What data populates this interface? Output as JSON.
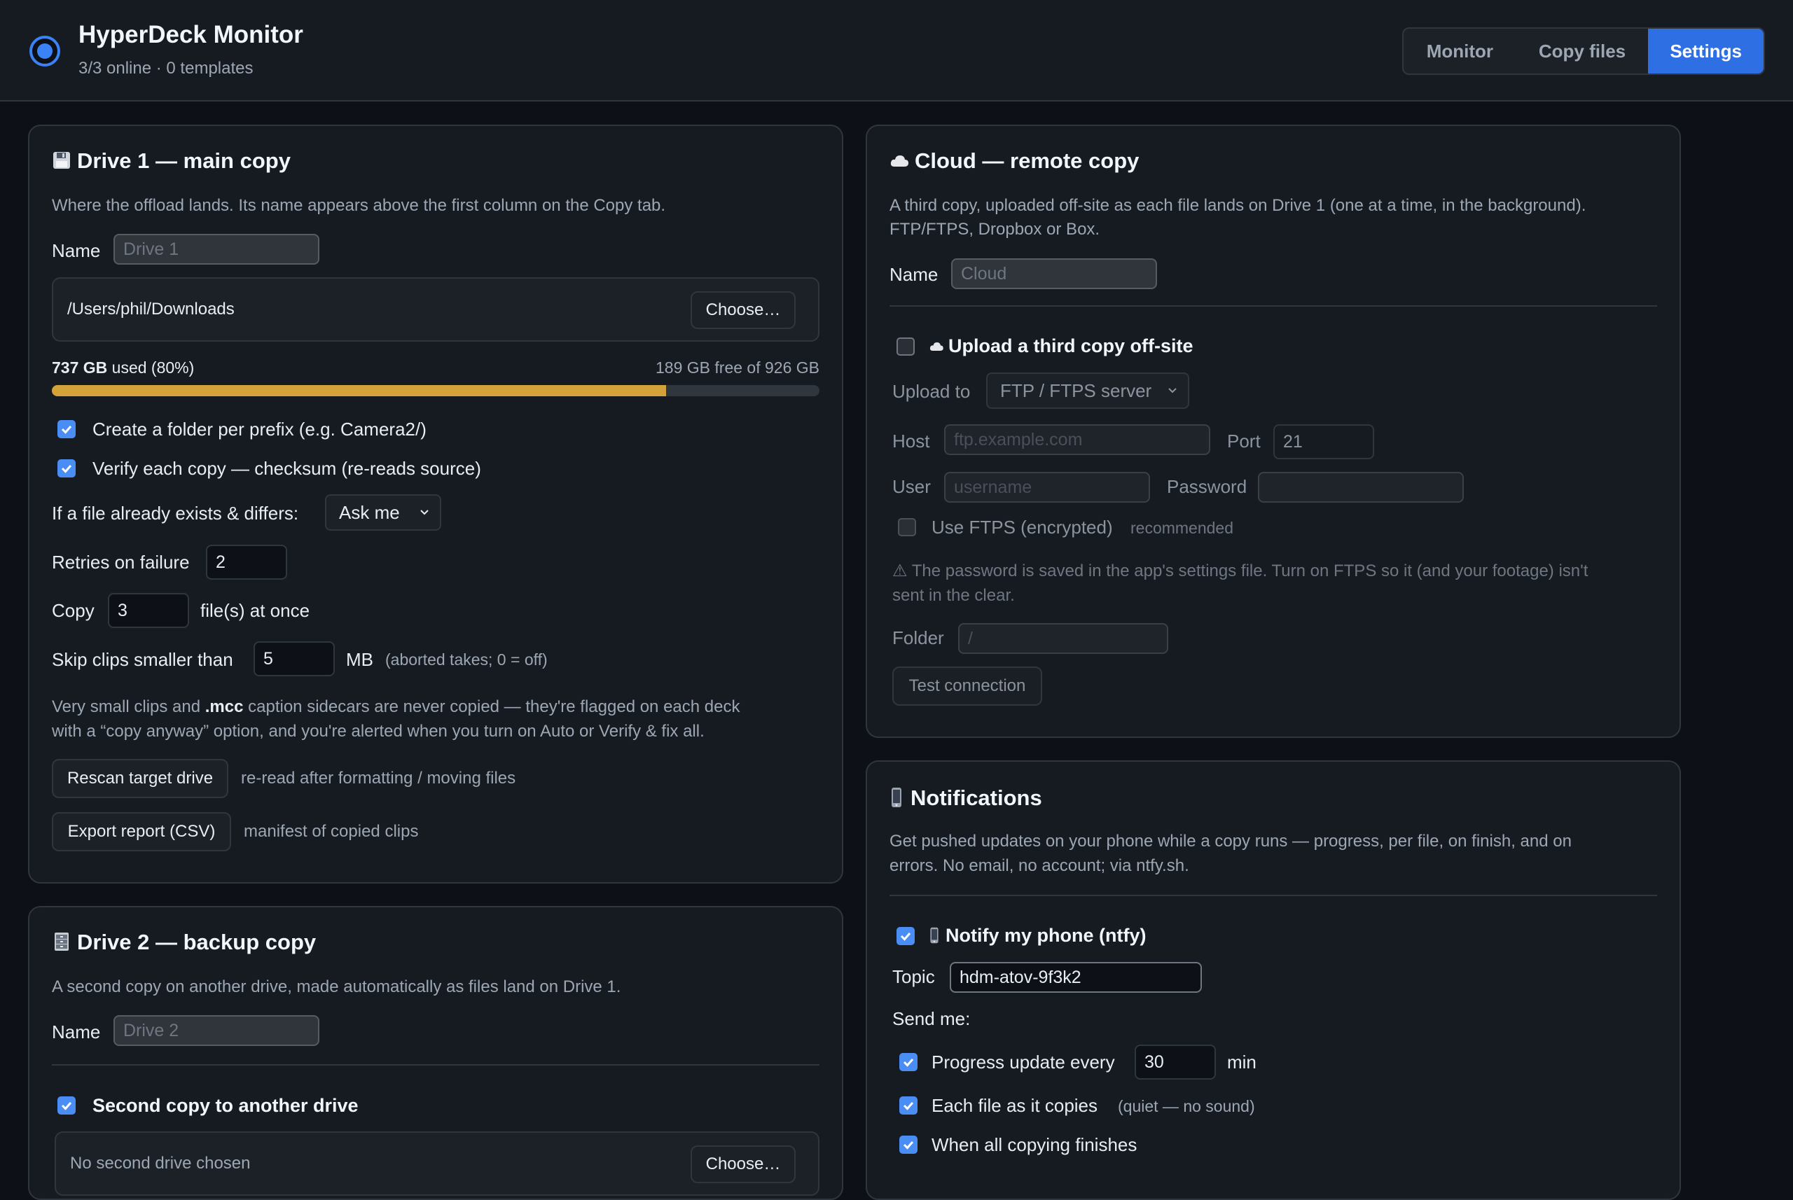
{
  "header": {
    "title": "HyperDeck Monitor",
    "subtitle": "3/3 online · 0 templates",
    "tabs": [
      {
        "label": "Monitor"
      },
      {
        "label": "Copy files"
      },
      {
        "label": "Settings"
      }
    ],
    "active_tab": "Settings"
  },
  "drive1": {
    "icon": "floppy-disk-icon",
    "title": "Drive 1 — main copy",
    "description": "Where the offload lands. Its name appears above the first column on the Copy tab.",
    "name_label": "Name",
    "name_placeholder": "Drive 1",
    "path": "/Users/phil/Downloads",
    "choose_label": "Choose…",
    "used_amount": "737 GB",
    "used_suffix": " used (80%)",
    "free_text": "189 GB free of 926 GB",
    "used_fraction": 0.8,
    "opt_folder_per_prefix": "Create a folder per prefix (e.g. Camera2/)",
    "opt_verify": "Verify each copy — checksum (re-reads source)",
    "exists_label": "If a file already exists & differs:",
    "exists_value": "Ask me",
    "retries_label": "Retries on failure",
    "retries_value": "2",
    "copy_label": "Copy",
    "copy_value": "3",
    "copy_suffix": "file(s) at once",
    "skip_label": "Skip clips smaller than",
    "skip_value": "5",
    "skip_unit": "MB",
    "skip_hint": "(aborted takes; 0 = off)",
    "note_line1_a": "Very small clips and ",
    "note_line1_b": ".mcc",
    "note_line1_c": " caption sidecars are never copied — they're flagged on each deck",
    "note_line2": "with a “copy anyway” option, and you're alerted when you turn on Auto or Verify & fix all.",
    "rescan_label": "Rescan target drive",
    "rescan_hint": "re-read after formatting / moving files",
    "export_label": "Export report (CSV)",
    "export_hint": "manifest of copied clips"
  },
  "drive2": {
    "icon": "file-cabinet-icon",
    "title": "Drive 2 — backup copy",
    "description": "A second copy on another drive, made automatically as files land on Drive 1.",
    "name_label": "Name",
    "name_placeholder": "Drive 2",
    "second_copy_label": "Second copy to another drive",
    "path_placeholder": "No second drive chosen",
    "choose_label": "Choose…"
  },
  "cloud": {
    "icon": "cloud-icon",
    "title": "Cloud — remote copy",
    "description_line1": "A third copy, uploaded off-site as each file lands on Drive 1 (one at a time, in the background).",
    "description_line2": "FTP/FTPS, Dropbox or Box.",
    "name_label": "Name",
    "name_placeholder": "Cloud",
    "upload_label": "Upload a third copy off-site",
    "upload_to_label": "Upload to",
    "upload_to_value": "FTP / FTPS server",
    "host_label": "Host",
    "host_placeholder": "ftp.example.com",
    "port_label": "Port",
    "port_value": "21",
    "user_label": "User",
    "user_placeholder": "username",
    "password_label": "Password",
    "ftps_label": "Use FTPS (encrypted)",
    "ftps_hint": "recommended",
    "warning_line1": "⚠ The password is saved in the app's settings file. Turn on FTPS so it (and your footage) isn't",
    "warning_line2": "sent in the clear.",
    "folder_label": "Folder",
    "folder_placeholder": "/",
    "test_label": "Test connection"
  },
  "notifications": {
    "icon": "mobile-phone-icon",
    "title": "Notifications",
    "description_line1": "Get pushed updates on your phone while a copy runs — progress, per file, on finish, and on",
    "description_line2": "errors. No email, no account; via ntfy.sh.",
    "notify_label": "Notify my phone (ntfy)",
    "topic_label": "Topic",
    "topic_value": "hdm-atov-9f3k2",
    "send_me_label": "Send me:",
    "progress_label": "Progress update every",
    "progress_value": "30",
    "progress_unit": "min",
    "each_file_label": "Each file as it copies",
    "each_file_hint": "(quiet — no sound)",
    "all_done_label": "When all copying finishes"
  }
}
